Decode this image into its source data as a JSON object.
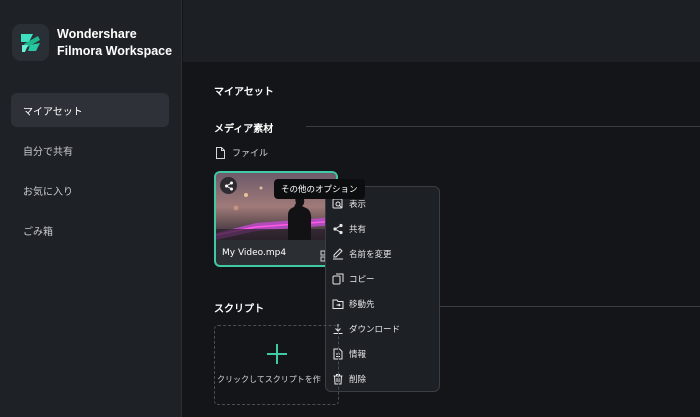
{
  "app": {
    "name_line1": "Wondershare",
    "name_line2": "Filmora Workspace"
  },
  "sidebar": {
    "items": [
      {
        "label": "マイアセット",
        "active": true
      },
      {
        "label": "自分で共有",
        "active": false
      },
      {
        "label": "お気に入り",
        "active": false
      },
      {
        "label": "ごみ箱",
        "active": false
      }
    ]
  },
  "main": {
    "title": "マイアセット",
    "media_section": "メディア素材",
    "file_label": "ファイル",
    "script_section": "スクリプト",
    "script_create_label": "クリックしてスクリプトを作"
  },
  "card": {
    "file_name": "My Video.mp4",
    "tooltip": "その他のオプション"
  },
  "context_menu": {
    "items": [
      {
        "label": "表示",
        "icon": "view-icon"
      },
      {
        "label": "共有",
        "icon": "share-icon"
      },
      {
        "label": "名前を変更",
        "icon": "rename-icon"
      },
      {
        "label": "コピー",
        "icon": "copy-icon"
      },
      {
        "label": "移動先",
        "icon": "move-folder-icon"
      },
      {
        "label": "ダウンロード",
        "icon": "download-icon"
      },
      {
        "label": "情報",
        "icon": "info-icon"
      },
      {
        "label": "削除",
        "icon": "trash-icon"
      }
    ]
  },
  "colors": {
    "accent": "#41c8a5",
    "sidebar_bg": "#1e2126",
    "main_bg": "#131518"
  }
}
